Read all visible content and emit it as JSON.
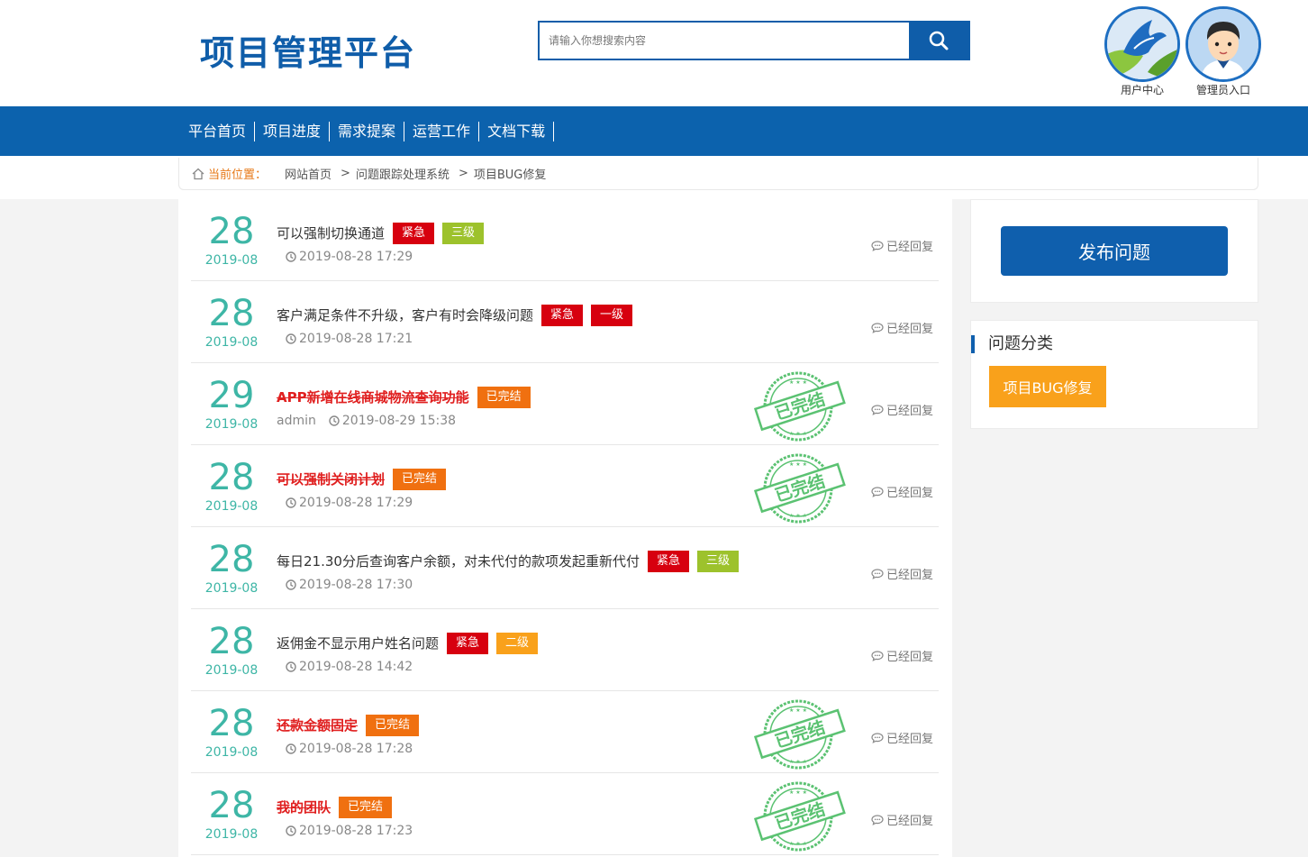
{
  "header": {
    "logo_text": "项目管理平台",
    "search_placeholder": "请输入你想搜索内容",
    "user_center_label": "用户中心",
    "admin_entry_label": "管理员入口"
  },
  "nav": {
    "items": [
      "平台首页",
      "项目进度",
      "需求提案",
      "运营工作",
      "文档下载"
    ]
  },
  "breadcrumb": {
    "current_label": "当前位置：",
    "items": [
      "网站首页",
      "问题跟踪处理系统",
      "项目BUG修复"
    ],
    "separator": ">"
  },
  "colors": {
    "brand_blue": "#0c62ad",
    "date_teal": "#3eb6a6",
    "tag_urgent": "#d7000f",
    "tag_level3": "#9dc22c",
    "tag_level2": "#f9a11b",
    "tag_done": "#f07010",
    "category_orange": "#f9a11b"
  },
  "issues": [
    {
      "day": "28",
      "ym": "2019-08",
      "title": "可以强制切换通道",
      "done": false,
      "tags": [
        {
          "text": "紧急",
          "type": "urgent"
        },
        {
          "text": "三级",
          "type": "level3"
        }
      ],
      "author": "",
      "datetime": "2019-08-28 17:29",
      "reply": "已经回复"
    },
    {
      "day": "28",
      "ym": "2019-08",
      "title": "客户满足条件不升级，客户有时会降级问题",
      "done": false,
      "tags": [
        {
          "text": "紧急",
          "type": "urgent"
        },
        {
          "text": "一级",
          "type": "urgent"
        }
      ],
      "author": "",
      "datetime": "2019-08-28 17:21",
      "reply": "已经回复"
    },
    {
      "day": "29",
      "ym": "2019-08",
      "title": "APP新增在线商城物流查询功能",
      "done": true,
      "tags": [
        {
          "text": "已完结",
          "type": "done"
        }
      ],
      "author": "admin",
      "datetime": "2019-08-29 15:38",
      "reply": "已经回复"
    },
    {
      "day": "28",
      "ym": "2019-08",
      "title": "可以强制关闭计划",
      "done": true,
      "tags": [
        {
          "text": "已完结",
          "type": "done"
        }
      ],
      "author": "",
      "datetime": "2019-08-28 17:29",
      "reply": "已经回复"
    },
    {
      "day": "28",
      "ym": "2019-08",
      "title": "每日21.30分后查询客户余额，对未代付的款项发起重新代付",
      "done": false,
      "tags": [
        {
          "text": "紧急",
          "type": "urgent"
        },
        {
          "text": "三级",
          "type": "level3"
        }
      ],
      "author": "",
      "datetime": "2019-08-28 17:30",
      "reply": "已经回复"
    },
    {
      "day": "28",
      "ym": "2019-08",
      "title": "返佣金不显示用户姓名问题",
      "done": false,
      "tags": [
        {
          "text": "紧急",
          "type": "urgent"
        },
        {
          "text": "二级",
          "type": "level2"
        }
      ],
      "author": "",
      "datetime": "2019-08-28 14:42",
      "reply": "已经回复"
    },
    {
      "day": "28",
      "ym": "2019-08",
      "title": "还款金额固定",
      "done": true,
      "tags": [
        {
          "text": "已完结",
          "type": "done"
        }
      ],
      "author": "",
      "datetime": "2019-08-28 17:28",
      "reply": "已经回复"
    },
    {
      "day": "28",
      "ym": "2019-08",
      "title": "我的团队",
      "done": true,
      "tags": [
        {
          "text": "已完结",
          "type": "done"
        }
      ],
      "author": "",
      "datetime": "2019-08-28 17:23",
      "reply": "已经回复"
    }
  ],
  "stamp_text": "已完结",
  "sidebar": {
    "publish_label": "发布问题",
    "category_title": "问题分类",
    "categories": [
      "项目BUG修复"
    ]
  }
}
